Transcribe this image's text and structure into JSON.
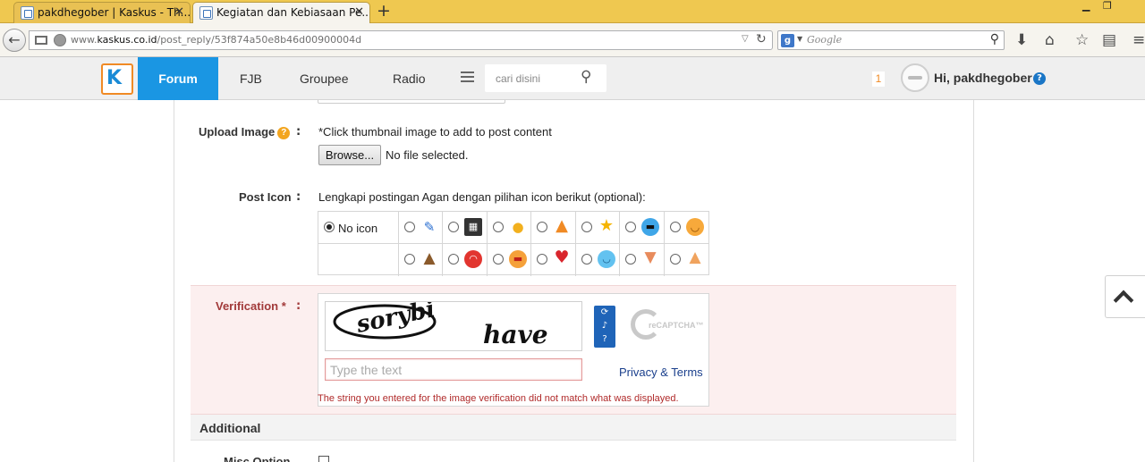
{
  "browser": {
    "tabs": [
      {
        "title": "pakdhegober | Kaskus - Th..."
      },
      {
        "title": "Kegiatan dan Kebiasaan Pe..."
      }
    ],
    "url_prefix": "www.",
    "url_domain": "kaskus.co.id",
    "url_path": "/post_reply/53f874a50e8b46d00900004d",
    "search_placeholder": "Google"
  },
  "site": {
    "nav": {
      "forum": "Forum",
      "fjb": "FJB",
      "groupee": "Groupee",
      "radio": "Radio"
    },
    "search_placeholder": "cari disini",
    "notif_count": "1",
    "greeting": "Hi, pakdhegober"
  },
  "form": {
    "upload": {
      "label": "Upload Image",
      "hint": "*Click thumbnail image to add to post content",
      "browse_label": "Browse...",
      "file_status": "No file selected."
    },
    "post_icon": {
      "label": "Post Icon",
      "hint": "Lengkapi postingan Agan dengan pilihan icon berikut (optional):",
      "no_icon_label": "No icon",
      "icons_row1": [
        "pencil-icon",
        "clapper-icon",
        "lightbulb-icon",
        "warning-icon",
        "star-icon",
        "cool-face-icon",
        "smile-face-icon"
      ],
      "icons_row2": [
        "poop-icon",
        "laugh-face-icon",
        "grin-face-icon",
        "heart-icon",
        "happy-face-icon",
        "thumbs-down-icon",
        "thumbs-up-icon"
      ]
    },
    "verification": {
      "label": "Verification *",
      "captcha_word_1": "sorybi",
      "captcha_word_2": "have",
      "recaptcha_brand": "reCAPTCHA™",
      "input_placeholder": "Type the text",
      "privacy_link": "Privacy & Terms",
      "error": "The string you entered for the image verification did not match what was displayed."
    },
    "additional": {
      "heading": "Additional",
      "misc_label": "Misc Option"
    }
  },
  "colors": {
    "nav_active": "#1a96e3",
    "tab_bar": "#efc850",
    "verification_bg": "#fcefef",
    "error_text": "#b02a2a"
  }
}
